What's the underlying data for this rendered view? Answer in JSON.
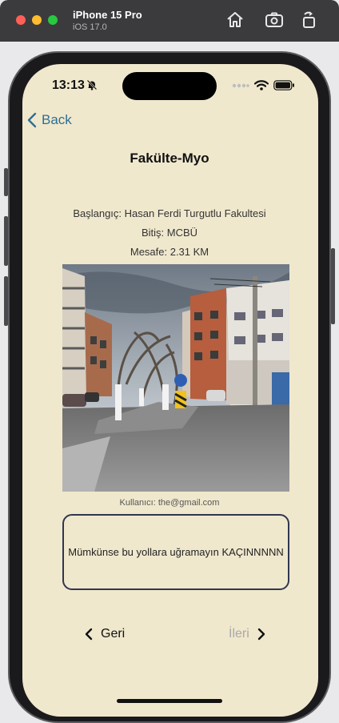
{
  "simulator": {
    "device_name": "iPhone 15 Pro",
    "os_version": "iOS 17.0",
    "icons": [
      "home-icon",
      "screenshot-icon",
      "rotate-icon"
    ]
  },
  "status_bar": {
    "time": "13:13",
    "icons": [
      "bell-slash-icon",
      "wifi-icon",
      "battery-icon"
    ]
  },
  "nav": {
    "back_label": "Back"
  },
  "route": {
    "title": "Fakülte-Myo",
    "start": "Başlangıç: Hasan Ferdi Turgutlu Fakultesi",
    "end": "Bitiş: MCBÜ",
    "distance": "Mesafe: 2.31 KM",
    "user": "Kullanıcı: the@gmail.com",
    "comment": "Mümkünse bu yollara uğramayın KAÇINNNNN"
  },
  "pager": {
    "prev_label": "Geri",
    "next_label": "İleri"
  },
  "colors": {
    "screen_bg": "#f0e8cd",
    "accent": "#2e6f94",
    "comment_border": "#2f3750",
    "disabled": "#a8a8a8"
  }
}
